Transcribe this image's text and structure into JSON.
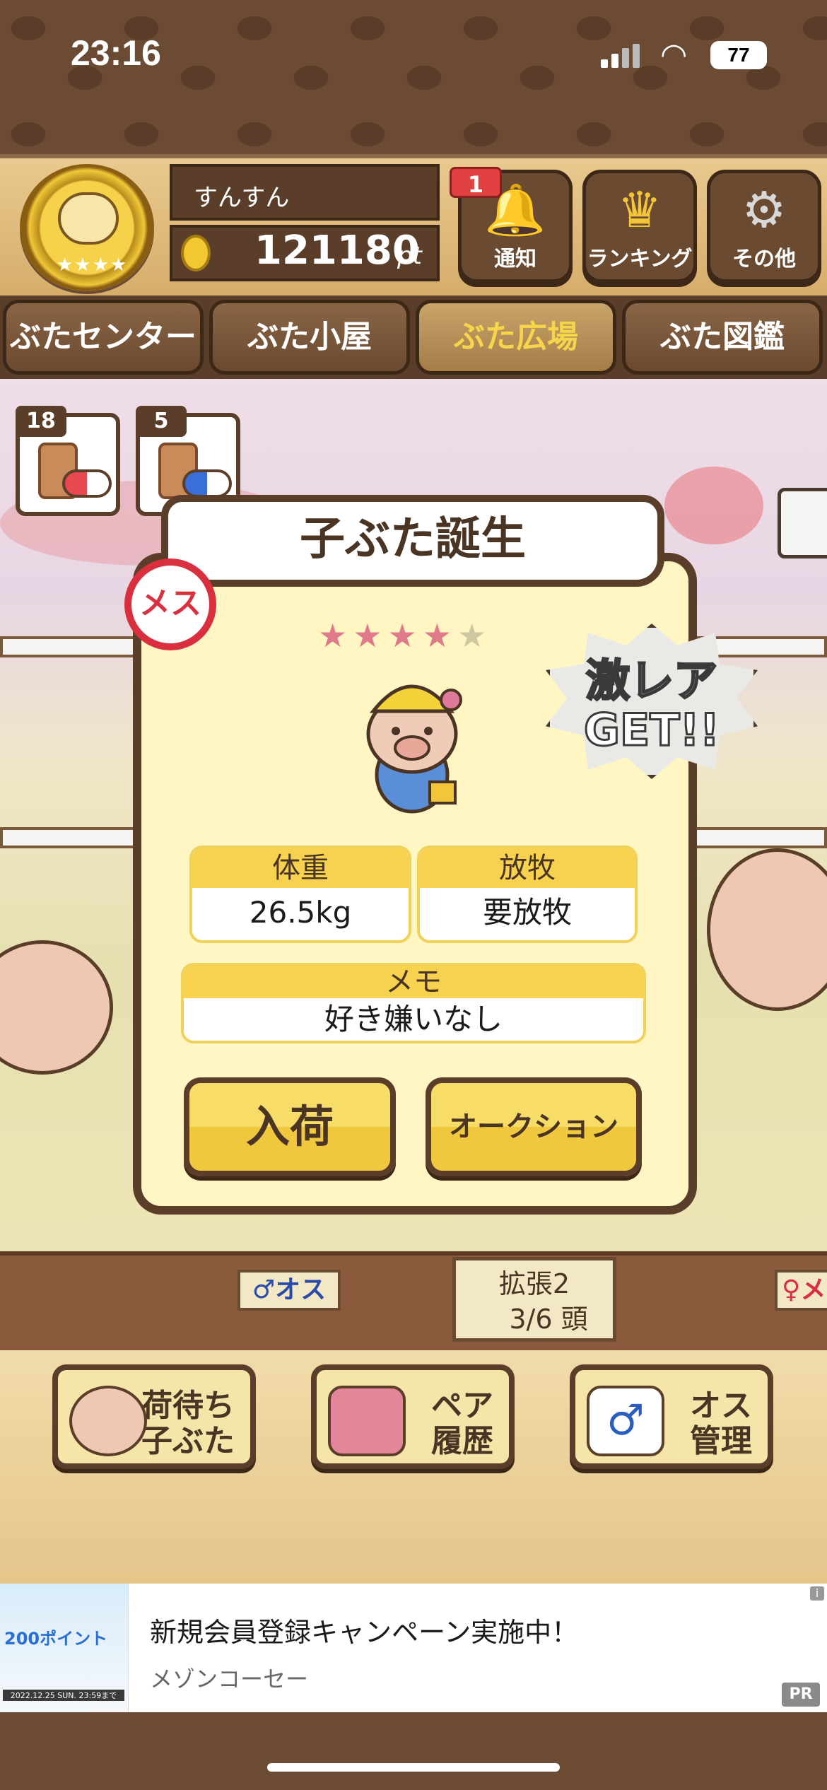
{
  "status_bar": {
    "time": "23:16",
    "battery": "77"
  },
  "header": {
    "username": "すんすん",
    "points": "121180",
    "points_unit": "pt",
    "notification_count": "1",
    "buttons": [
      {
        "label": "通知",
        "icon": "bell-icon"
      },
      {
        "label": "ランキング",
        "icon": "crown-icon"
      },
      {
        "label": "その他",
        "icon": "gear-icon"
      }
    ]
  },
  "nav_tabs": [
    {
      "label": "ぶたセンター"
    },
    {
      "label": "ぶた小屋"
    },
    {
      "label": "ぶた広場",
      "active": true
    },
    {
      "label": "ぶた図鑑"
    }
  ],
  "items": [
    {
      "count": "18",
      "icon": "female-potion-icon"
    },
    {
      "count": "5",
      "icon": "male-potion-icon"
    }
  ],
  "modal": {
    "title": "子ぶた誕生",
    "gender_label": "メス",
    "stars_filled": 4,
    "stars_total": 5,
    "rare_label_line1": "激レア",
    "rare_label_line2": "GET!!",
    "weight_header": "体重",
    "weight_value": "26.5kg",
    "pasture_header": "放牧",
    "pasture_value": "要放牧",
    "memo_header": "メモ",
    "memo_value": "好き嫌いなし",
    "accept_button": "入荷",
    "auction_button": "オークション"
  },
  "scene": {
    "male_sign": "♂オス",
    "female_sign": "♀メ",
    "capacity_line1": "拡張2",
    "capacity_line2": "3/6 頭"
  },
  "bottom_buttons": [
    {
      "line1": "入荷待ち",
      "line2": "子ぶた",
      "icon": "piglet-icon"
    },
    {
      "line1": "ペア",
      "line2": "履歴",
      "icon": "book-heart-icon"
    },
    {
      "line1": "オス",
      "line2": "管理",
      "icon": "male-document-icon"
    }
  ],
  "ad": {
    "title": "新規会員登録キャンペーン実施中！",
    "advertiser": "メゾンコーセー",
    "badge": "PR",
    "image_points": "200ポイント",
    "image_date": "2022.12.25 SUN. 23:59まで"
  },
  "colors": {
    "wood_dark": "#5a3e2a",
    "gold": "#f6d24e",
    "female_red": "#d92f3e",
    "male_blue": "#2a4aa8"
  }
}
